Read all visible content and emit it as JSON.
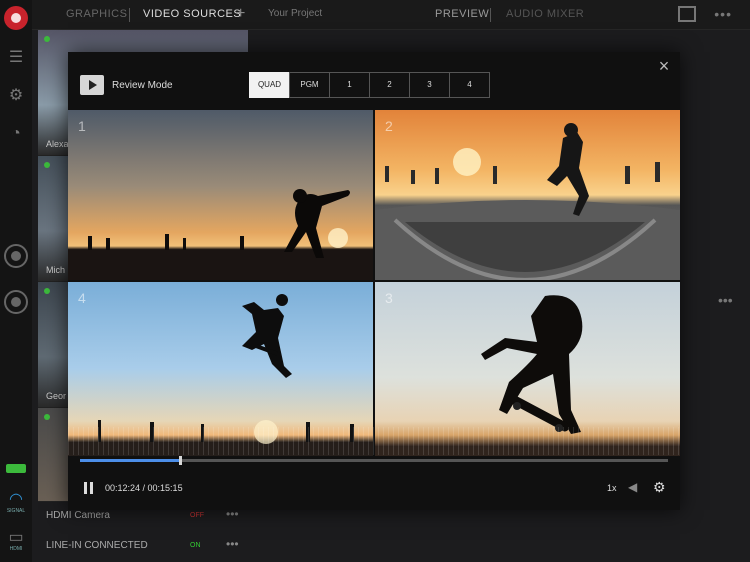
{
  "topbar": {
    "tab_graphics": "GRAPHICS",
    "tab_video_sources": "VIDEO SOURCES",
    "add_icon": "+",
    "project": "Your Project",
    "tab_preview": "PREVIEW",
    "tab_audio_mixer": "AUDIO MIXER",
    "more": "•••"
  },
  "rail": {
    "wifi_label": "SIGNAL",
    "hdmi_label": "HDMI"
  },
  "sources": {
    "thumbs": [
      {
        "name": "Alexa"
      },
      {
        "name": "Mich"
      },
      {
        "name": "Geor"
      }
    ],
    "rows": [
      {
        "label": "HDMI Camera",
        "state": "OFF"
      },
      {
        "label": "LINE-IN CONNECTED",
        "state": "ON"
      }
    ],
    "row_more": "•••"
  },
  "modal": {
    "review_label": "Review Mode",
    "segments": [
      "QUAD",
      "PGM",
      "1",
      "2",
      "3",
      "4"
    ],
    "active_segment": "QUAD",
    "cells": [
      "1",
      "2",
      "4",
      "3"
    ],
    "current_time": "00:12:24",
    "total_time": "00:15:15",
    "time_display": "00:12:24 / 00:15:15",
    "progress_fraction": 0.17,
    "speed": "1x",
    "accent_color": "#4c8ee8"
  }
}
